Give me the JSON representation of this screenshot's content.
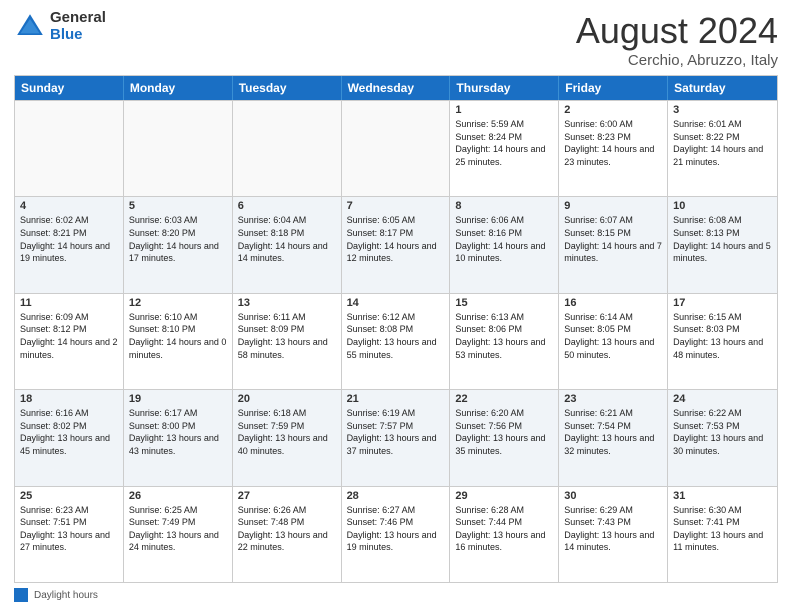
{
  "logo": {
    "general": "General",
    "blue": "Blue"
  },
  "title": {
    "month": "August 2024",
    "location": "Cerchio, Abruzzo, Italy"
  },
  "calendar": {
    "headers": [
      "Sunday",
      "Monday",
      "Tuesday",
      "Wednesday",
      "Thursday",
      "Friday",
      "Saturday"
    ],
    "rows": [
      [
        {
          "day": "",
          "info": "",
          "empty": true
        },
        {
          "day": "",
          "info": "",
          "empty": true
        },
        {
          "day": "",
          "info": "",
          "empty": true
        },
        {
          "day": "",
          "info": "",
          "empty": true
        },
        {
          "day": "1",
          "info": "Sunrise: 5:59 AM\nSunset: 8:24 PM\nDaylight: 14 hours and 25 minutes."
        },
        {
          "day": "2",
          "info": "Sunrise: 6:00 AM\nSunset: 8:23 PM\nDaylight: 14 hours and 23 minutes."
        },
        {
          "day": "3",
          "info": "Sunrise: 6:01 AM\nSunset: 8:22 PM\nDaylight: 14 hours and 21 minutes."
        }
      ],
      [
        {
          "day": "4",
          "info": "Sunrise: 6:02 AM\nSunset: 8:21 PM\nDaylight: 14 hours and 19 minutes."
        },
        {
          "day": "5",
          "info": "Sunrise: 6:03 AM\nSunset: 8:20 PM\nDaylight: 14 hours and 17 minutes."
        },
        {
          "day": "6",
          "info": "Sunrise: 6:04 AM\nSunset: 8:18 PM\nDaylight: 14 hours and 14 minutes."
        },
        {
          "day": "7",
          "info": "Sunrise: 6:05 AM\nSunset: 8:17 PM\nDaylight: 14 hours and 12 minutes."
        },
        {
          "day": "8",
          "info": "Sunrise: 6:06 AM\nSunset: 8:16 PM\nDaylight: 14 hours and 10 minutes."
        },
        {
          "day": "9",
          "info": "Sunrise: 6:07 AM\nSunset: 8:15 PM\nDaylight: 14 hours and 7 minutes."
        },
        {
          "day": "10",
          "info": "Sunrise: 6:08 AM\nSunset: 8:13 PM\nDaylight: 14 hours and 5 minutes."
        }
      ],
      [
        {
          "day": "11",
          "info": "Sunrise: 6:09 AM\nSunset: 8:12 PM\nDaylight: 14 hours and 2 minutes."
        },
        {
          "day": "12",
          "info": "Sunrise: 6:10 AM\nSunset: 8:10 PM\nDaylight: 14 hours and 0 minutes."
        },
        {
          "day": "13",
          "info": "Sunrise: 6:11 AM\nSunset: 8:09 PM\nDaylight: 13 hours and 58 minutes."
        },
        {
          "day": "14",
          "info": "Sunrise: 6:12 AM\nSunset: 8:08 PM\nDaylight: 13 hours and 55 minutes."
        },
        {
          "day": "15",
          "info": "Sunrise: 6:13 AM\nSunset: 8:06 PM\nDaylight: 13 hours and 53 minutes."
        },
        {
          "day": "16",
          "info": "Sunrise: 6:14 AM\nSunset: 8:05 PM\nDaylight: 13 hours and 50 minutes."
        },
        {
          "day": "17",
          "info": "Sunrise: 6:15 AM\nSunset: 8:03 PM\nDaylight: 13 hours and 48 minutes."
        }
      ],
      [
        {
          "day": "18",
          "info": "Sunrise: 6:16 AM\nSunset: 8:02 PM\nDaylight: 13 hours and 45 minutes."
        },
        {
          "day": "19",
          "info": "Sunrise: 6:17 AM\nSunset: 8:00 PM\nDaylight: 13 hours and 43 minutes."
        },
        {
          "day": "20",
          "info": "Sunrise: 6:18 AM\nSunset: 7:59 PM\nDaylight: 13 hours and 40 minutes."
        },
        {
          "day": "21",
          "info": "Sunrise: 6:19 AM\nSunset: 7:57 PM\nDaylight: 13 hours and 37 minutes."
        },
        {
          "day": "22",
          "info": "Sunrise: 6:20 AM\nSunset: 7:56 PM\nDaylight: 13 hours and 35 minutes."
        },
        {
          "day": "23",
          "info": "Sunrise: 6:21 AM\nSunset: 7:54 PM\nDaylight: 13 hours and 32 minutes."
        },
        {
          "day": "24",
          "info": "Sunrise: 6:22 AM\nSunset: 7:53 PM\nDaylight: 13 hours and 30 minutes."
        }
      ],
      [
        {
          "day": "25",
          "info": "Sunrise: 6:23 AM\nSunset: 7:51 PM\nDaylight: 13 hours and 27 minutes."
        },
        {
          "day": "26",
          "info": "Sunrise: 6:25 AM\nSunset: 7:49 PM\nDaylight: 13 hours and 24 minutes."
        },
        {
          "day": "27",
          "info": "Sunrise: 6:26 AM\nSunset: 7:48 PM\nDaylight: 13 hours and 22 minutes."
        },
        {
          "day": "28",
          "info": "Sunrise: 6:27 AM\nSunset: 7:46 PM\nDaylight: 13 hours and 19 minutes."
        },
        {
          "day": "29",
          "info": "Sunrise: 6:28 AM\nSunset: 7:44 PM\nDaylight: 13 hours and 16 minutes."
        },
        {
          "day": "30",
          "info": "Sunrise: 6:29 AM\nSunset: 7:43 PM\nDaylight: 13 hours and 14 minutes."
        },
        {
          "day": "31",
          "info": "Sunrise: 6:30 AM\nSunset: 7:41 PM\nDaylight: 13 hours and 11 minutes."
        }
      ]
    ]
  },
  "footer": {
    "label": "Daylight hours"
  }
}
